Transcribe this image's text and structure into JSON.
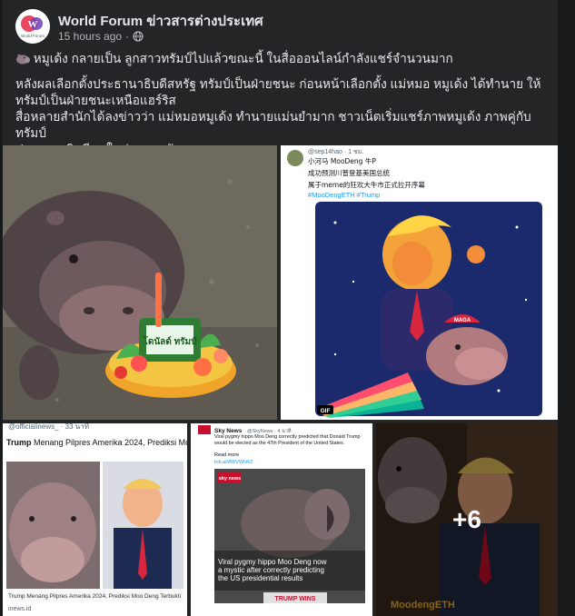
{
  "page": {
    "name": "World Forum ข่าวสารต่างประเทศ",
    "time": "15 hours ago",
    "separator": "·",
    "privacy_icon": "globe-icon",
    "avatar_text": "World Forum"
  },
  "post": {
    "line1": "หมูเด้ง กลายเป็น ลูกสาวทรัมป์ไปแล้วขณะนี้ ในสื่อออนไลน์กำลังแชร์จำนวนมาก",
    "line1_icon": "hippo-icon",
    "line2": "หลังผลเลือกตั้งประธานาธิบดีสหรัฐ ทรัมป์เป็นฝ่ายชนะ  ก่อนหน้าเลือกตั้ง แม่หมอ หมูเด้ง ได้ทำนาย ให้",
    "line3": "ทรัมป์เป็นฝ่ายชนะเหนือแฮร์ริส",
    "line4": "สื่อหลายสำนักได้ลงข่าวว่า แม่หมอหมูเด้ง ทำนายแม่นยำมาก   ชาวเน็ตเริ่มแชร์ภาพหมูเด้ง  ภาพคู่กับทรัมป์",
    "line5": "ประธานาธิบดีคนใหม่ของสหรัฐ"
  },
  "photo1": {
    "sign_text": "โดนัลด์ ทรัมป์"
  },
  "photo2": {
    "handle": "@sep14hao · 1 ชม.",
    "line1": "小河马 MooDeng 牛P",
    "line2": "成功预测川普登基美国总统",
    "line3": "属于meme的狂欢大牛市正式拉开序幕",
    "hashtags": "#MooDengETH #Trump",
    "cap_text": "MAGA",
    "gif_badge": "GIF"
  },
  "photo3": {
    "handle": "@officialinews_ · 33 นาที",
    "headline_a": "Trump",
    "headline_b": " Menang Pilpres Amerika 2024, Prediksi Moo",
    "caption": "Trump Menang Pilpres Amerika 2024, Prediksi Moo Deng Terbukti",
    "source": "inews.id"
  },
  "photo4": {
    "outlet": "Sky News",
    "handle": "@SkyNews · 4 นาที",
    "text": "Viral pygmy hippo Moo Deng correctly predicted that Donald Trump would be elected as the 47th President of the United States.",
    "read_more": "Read more",
    "link": "trib.al/8WVWhRZ",
    "brand": "sky news",
    "image_caption": "Viral pygmy hippo Moo Deng now a mystic after correctly predicting the US presidential results",
    "banner": "TRUMP WINS"
  },
  "photo5": {
    "more_count": "+6",
    "brand_text": "MoodengETH"
  }
}
